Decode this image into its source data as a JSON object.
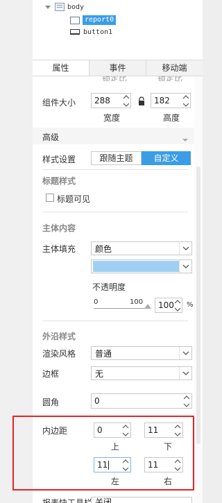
{
  "tree": {
    "body_label": "body",
    "report_label": "report0",
    "button_label": "button1"
  },
  "tabs": [
    "属性",
    "事件",
    "移动端"
  ],
  "size": {
    "label": "组件大小",
    "width_value": "288",
    "height_value": "182",
    "width_caption": "宽度",
    "height_caption": "高度",
    "lock_icon": "lock-icon"
  },
  "advanced": {
    "label": "高级"
  },
  "style_setting": {
    "label": "样式设置",
    "options": [
      "跟随主题",
      "自定义"
    ],
    "selected": "自定义"
  },
  "title_style": {
    "section": "标题样式",
    "checkbox_label": "标题可见"
  },
  "body_content": {
    "section": "主体内容",
    "fill_label": "主体填充",
    "fill_value": "颜色",
    "fill_color": "#9fd0f3",
    "opacity_label": "不透明度",
    "slider_min": "0",
    "slider_max": "100",
    "opacity_value": "100",
    "percent_sign": "%"
  },
  "border_style": {
    "section": "外沿样式",
    "render_label": "渲染风格",
    "render_value": "普通",
    "border_label": "边框",
    "border_value": "无",
    "radius_label": "圆角",
    "radius_value": "0"
  },
  "padding": {
    "label": "内边距",
    "top": "0",
    "bottom": "11",
    "left": "11",
    "right": "11",
    "top_caption": "上",
    "bottom_caption": "下",
    "left_caption": "左",
    "right_caption": "右"
  },
  "cut_off": {
    "top_left": "锁定比",
    "top_right": "锁定比",
    "bottom_label": "报表快工具栏",
    "bottom_value": "关闭"
  },
  "colors": {
    "accent": "#3a9de6",
    "highlight": "#e52424"
  }
}
